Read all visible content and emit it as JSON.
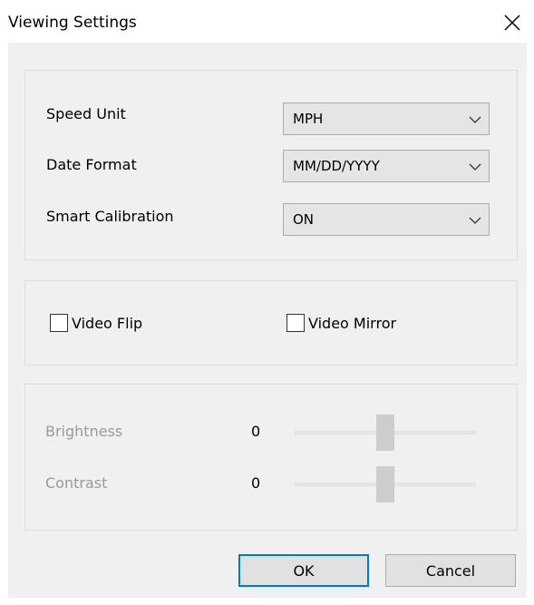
{
  "window": {
    "title": "Viewing Settings",
    "close_icon": "close-icon"
  },
  "settings": {
    "speed_unit": {
      "label": "Speed Unit",
      "value": "MPH"
    },
    "date_format": {
      "label": "Date Format",
      "value": "MM/DD/YYYY"
    },
    "smart_calibration": {
      "label": "Smart Calibration",
      "value": "ON"
    }
  },
  "video": {
    "flip": {
      "label": "Video Flip",
      "checked": false
    },
    "mirror": {
      "label": "Video Mirror",
      "checked": false
    }
  },
  "image": {
    "brightness": {
      "label": "Brightness",
      "value": "0",
      "level": 0.5
    },
    "contrast": {
      "label": "Contrast",
      "value": "0",
      "level": 0.5
    }
  },
  "buttons": {
    "ok": "OK",
    "cancel": "Cancel"
  },
  "colors": {
    "default_button_border": "#0078d7",
    "disabled_text": "#9a9a9a",
    "dialog_body": "#f0f0f0"
  }
}
